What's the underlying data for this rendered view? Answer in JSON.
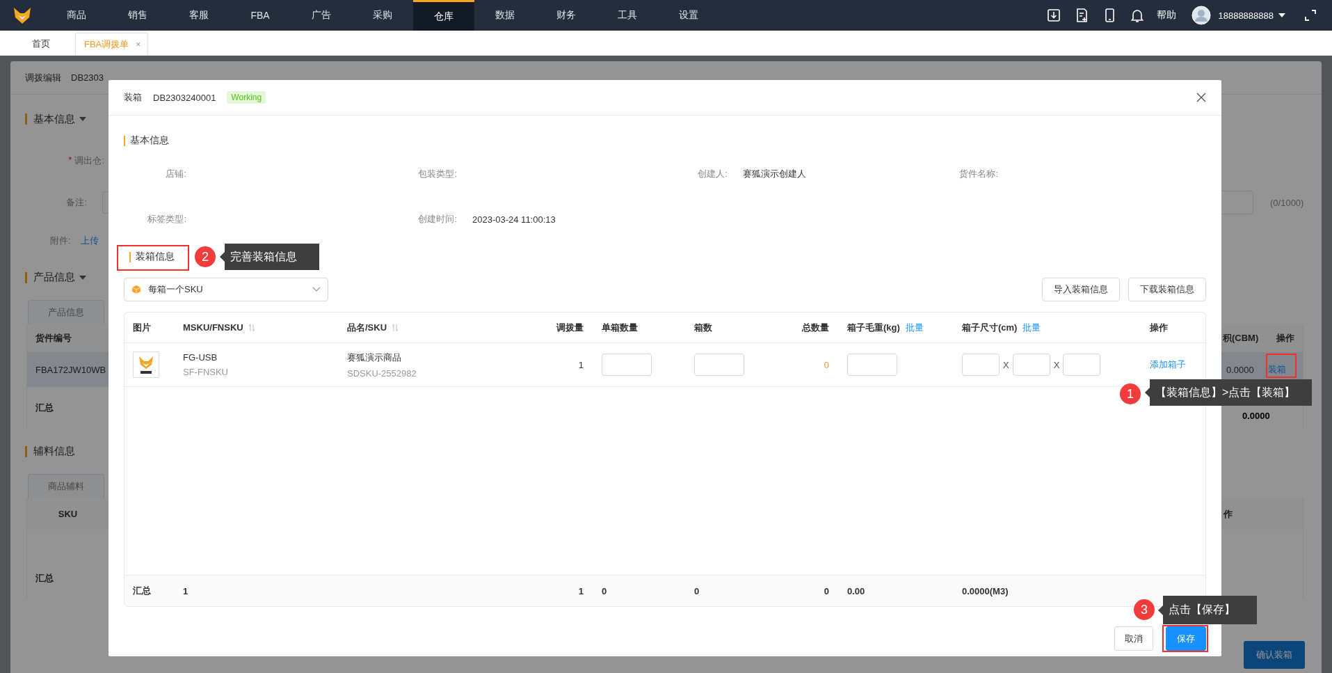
{
  "top_nav": {
    "menu": [
      {
        "label": "商品",
        "selected": false
      },
      {
        "label": "销售",
        "selected": false
      },
      {
        "label": "客服",
        "selected": false
      },
      {
        "label": "FBA",
        "selected": false
      },
      {
        "label": "广告",
        "selected": false
      },
      {
        "label": "采购",
        "selected": false
      },
      {
        "label": "仓库",
        "selected": true
      },
      {
        "label": "数据",
        "selected": false
      },
      {
        "label": "财务",
        "selected": false
      },
      {
        "label": "工具",
        "selected": false
      },
      {
        "label": "设置",
        "selected": false
      }
    ],
    "help": "帮助",
    "user": "18888888888"
  },
  "page_tabs": [
    {
      "label": "首页",
      "selected": false
    },
    {
      "label": "FBA调拨单",
      "selected": true,
      "close": "×"
    }
  ],
  "background": {
    "title": "调拨编辑",
    "doc_no": "DB2303",
    "basic_section": "基本信息",
    "required_mark": "*",
    "warehouse_label": "调出仓:",
    "note_label": "备注:",
    "note_counter": "(0/1000)",
    "attachment_label": "附件:",
    "upload_link": "上传",
    "product_section": "产品信息",
    "product_tab": "产品信息",
    "product_columns": [
      "货件编号",
      "积(CBM)",
      "操作"
    ],
    "product_row": {
      "shipment_no": "FBA172JW10WB",
      "volume": "0.0000",
      "action": "装箱"
    },
    "product_total": {
      "label": "汇总",
      "volume": "0.0000"
    },
    "material_section": "辅料信息",
    "material_tab": "商品辅料",
    "material_columns": [
      "SKU",
      "作"
    ],
    "material_total": "汇总",
    "confirm_button": "确认装箱"
  },
  "modal": {
    "title": "装箱",
    "doc_no": "DB2303240001",
    "status": "Working",
    "basic_section": "基本信息",
    "info": [
      {
        "label": "店铺:"
      },
      {
        "label": "包装类型:"
      },
      {
        "label": "创建人:",
        "value": "赛狐演示创建人"
      },
      {
        "label": "货件名称:"
      },
      {
        "label": "标签类型:"
      },
      {
        "label": "创建时间:",
        "value": "2023-03-24 11:00:13"
      }
    ],
    "packing_section": "装箱信息",
    "packing_mode": "每箱一个SKU",
    "actions": [
      "导入装箱信息",
      "下载装箱信息"
    ],
    "columns": [
      {
        "label": "图片",
        "sortable": false
      },
      {
        "label": "MSKU/FNSKU",
        "sortable": true
      },
      {
        "label": "品名/SKU",
        "sortable": true
      },
      {
        "label": "调拨量",
        "sortable": false
      },
      {
        "label": "单箱数量",
        "sortable": false
      },
      {
        "label": "箱数",
        "sortable": false
      },
      {
        "label": "总数量",
        "sortable": false
      },
      {
        "label": "箱子毛重(kg)",
        "sortable": false,
        "link": "批量"
      },
      {
        "label": "箱子尺寸(cm)",
        "sortable": false,
        "link": "批量"
      },
      {
        "label": "操作",
        "sortable": false
      }
    ],
    "rows": [
      {
        "image": {
          "kind": "picture"
        },
        "msku": "FG-USB",
        "fnsku": "SF-FNSKU",
        "name": "赛狐演示商品",
        "sku": "SDSKU-2552982",
        "qty": "1",
        "total": "0",
        "dimension_separators": [
          "X",
          "X"
        ],
        "action": "添加箱子"
      }
    ],
    "totals": {
      "label": "汇总",
      "msku": "1",
      "qty": "1",
      "per_box": "0",
      "boxes": "0",
      "total": "0",
      "weight": "0.00",
      "volume": "0.0000(M3)"
    },
    "buttons": [
      {
        "label": "取消",
        "kind": "default"
      },
      {
        "label": "保存",
        "kind": "primary"
      }
    ]
  },
  "annotations": [
    {
      "number": "1",
      "text": "【装箱信息】>点击【装箱】"
    },
    {
      "number": "2",
      "text": "完善装箱信息"
    },
    {
      "number": "3",
      "text": "点击【保存】"
    }
  ]
}
